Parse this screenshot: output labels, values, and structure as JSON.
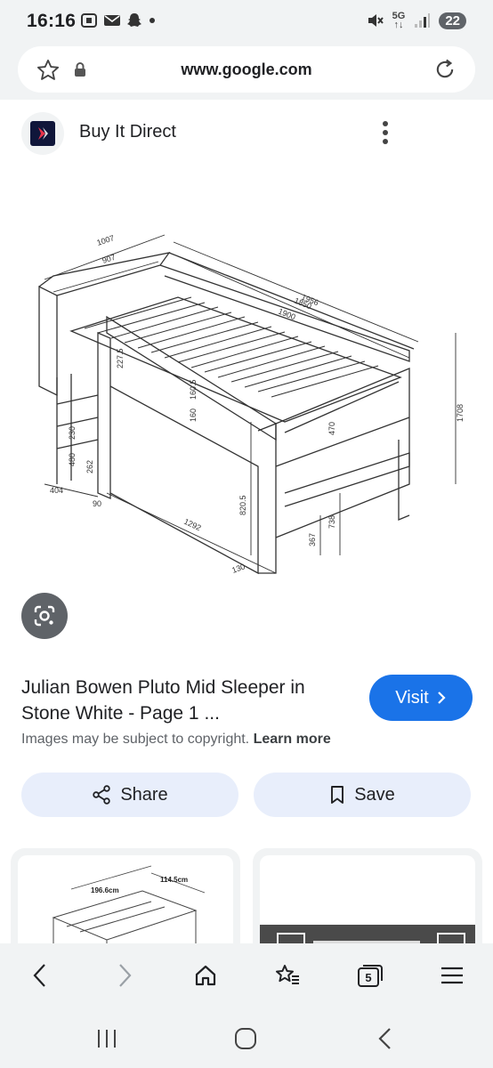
{
  "status_bar": {
    "time": "16:16",
    "network": "5G",
    "battery": "22",
    "icons_left": [
      "screenshot-icon",
      "mail-icon",
      "snapchat-icon",
      "dot-icon"
    ],
    "icons_right": [
      "mute-icon",
      "network-icon",
      "signal-icon",
      "battery-icon"
    ]
  },
  "browser": {
    "url": "www.google.com"
  },
  "result": {
    "source_name": "Buy It Direct",
    "title": "Julian Bowen Pluto Mid Sleeper in Stone White - Page 1 ...",
    "copyright_text": "Images may be subject to copyright.",
    "learn_more": "Learn more",
    "visit_label": "Visit",
    "share_label": "Share",
    "save_label": "Save"
  },
  "diagram": {
    "dimensions": [
      "1007",
      "907",
      "1956",
      "1900",
      "1850",
      "1708",
      "1292",
      "820.5",
      "404",
      "90",
      "480",
      "470",
      "738",
      "367",
      "227.5",
      "160.5",
      "160",
      "262",
      "230",
      "130"
    ]
  },
  "related": [
    {
      "labels": [
        "196.6cm",
        "114.5cm"
      ]
    },
    {
      "labels": []
    }
  ],
  "bottom_nav": {
    "tabs_count": "5"
  },
  "colors": {
    "accent": "#1a73e8",
    "chip_bg": "#e8eefb",
    "chrome_bg": "#f1f3f4"
  }
}
